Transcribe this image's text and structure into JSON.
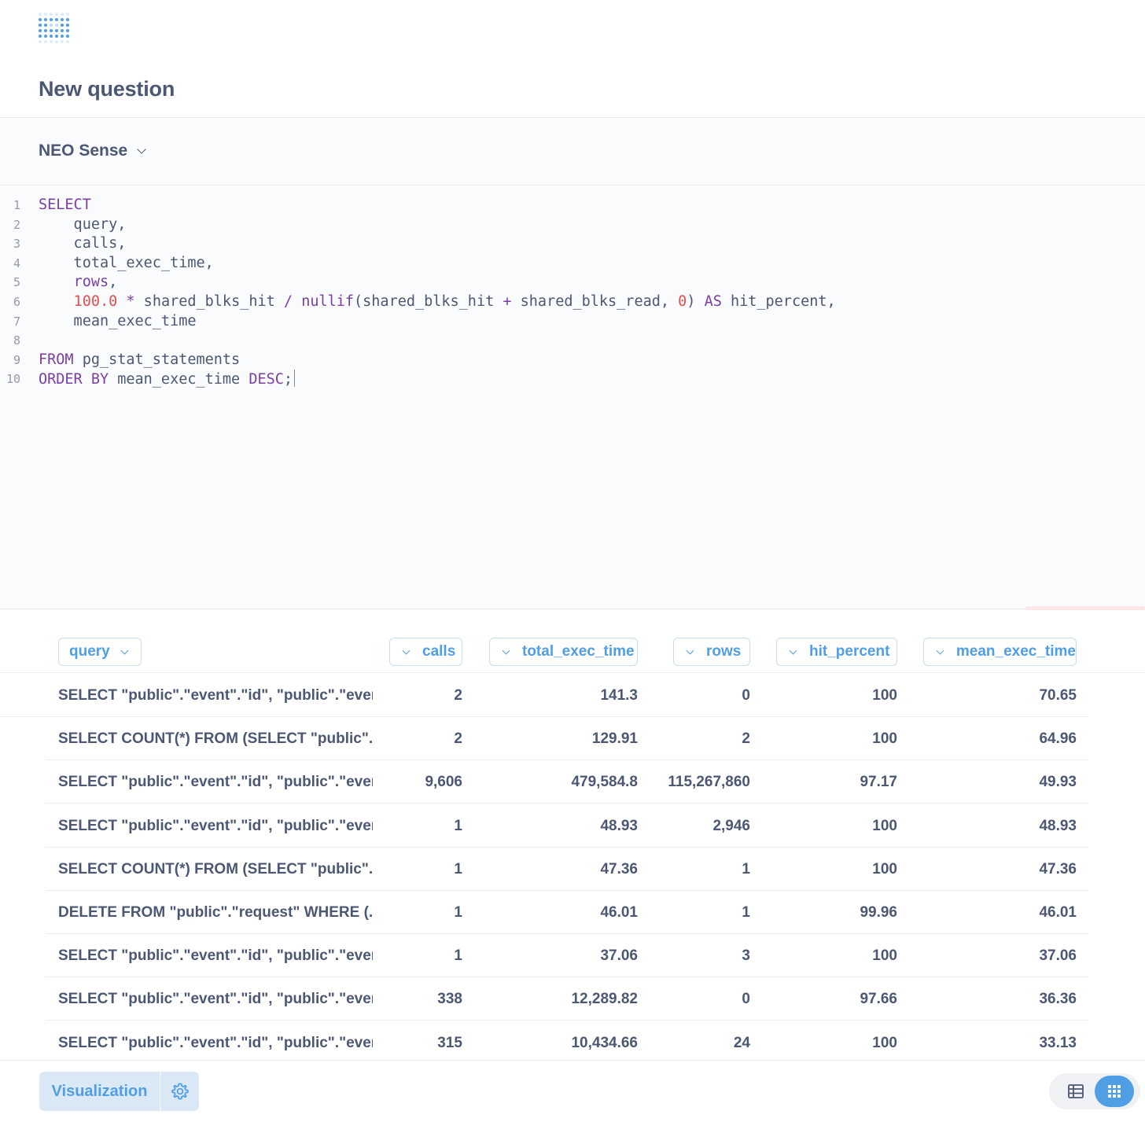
{
  "header": {
    "title": "New question"
  },
  "database": {
    "name": "NEO Sense"
  },
  "editor": {
    "lines": [
      {
        "n": "1",
        "html": "<span class=\"kw\">SELECT</span>"
      },
      {
        "n": "2",
        "html": "    query,"
      },
      {
        "n": "3",
        "html": "    calls,"
      },
      {
        "n": "4",
        "html": "    total_exec_time,"
      },
      {
        "n": "5",
        "html": "    <span class=\"fn\">rows</span>,"
      },
      {
        "n": "6",
        "html": "    <span class=\"num\">100.0</span> <span class=\"op\">*</span> shared_blks_hit <span class=\"op\">/</span> <span class=\"fn\">nullif</span>(shared_blks_hit <span class=\"op\">+</span> shared_blks_read, <span class=\"num\">0</span>) <span class=\"kw\">AS</span> hit_percent,"
      },
      {
        "n": "7",
        "html": "    mean_exec_time"
      },
      {
        "n": "8",
        "html": ""
      },
      {
        "n": "9",
        "html": "<span class=\"kw\">FROM</span> pg_stat_statements"
      },
      {
        "n": "10",
        "html": "<span class=\"kw\">ORDER BY</span> mean_exec_time <span class=\"kw\">DESC</span>;<span class=\"cursor\"></span>"
      }
    ]
  },
  "table": {
    "columns": [
      "query",
      "calls",
      "total_exec_time",
      "rows",
      "hit_percent",
      "mean_exec_time"
    ],
    "rows": [
      [
        "SELECT \"public\".\"event\".\"id\", \"public\".\"event\"...",
        "2",
        "141.3",
        "0",
        "100",
        "70.65"
      ],
      [
        "SELECT COUNT(*) FROM (SELECT \"public\"...",
        "2",
        "129.91",
        "2",
        "100",
        "64.96"
      ],
      [
        "SELECT \"public\".\"event\".\"id\", \"public\".\"event\"...",
        "9,606",
        "479,584.8",
        "115,267,860",
        "97.17",
        "49.93"
      ],
      [
        "SELECT \"public\".\"event\".\"id\", \"public\".\"event\"...",
        "1",
        "48.93",
        "2,946",
        "100",
        "48.93"
      ],
      [
        "SELECT COUNT(*) FROM (SELECT \"public\"...",
        "1",
        "47.36",
        "1",
        "100",
        "47.36"
      ],
      [
        "DELETE FROM \"public\".\"request\" WHERE (...",
        "1",
        "46.01",
        "1",
        "99.96",
        "46.01"
      ],
      [
        "SELECT \"public\".\"event\".\"id\", \"public\".\"event\"...",
        "1",
        "37.06",
        "3",
        "100",
        "37.06"
      ],
      [
        "SELECT \"public\".\"event\".\"id\", \"public\".\"event\"...",
        "338",
        "12,289.82",
        "0",
        "97.66",
        "36.36"
      ],
      [
        "SELECT \"public\".\"event\".\"id\", \"public\".\"event\"...",
        "315",
        "10,434.66",
        "24",
        "100",
        "33.13"
      ]
    ]
  },
  "footer": {
    "visualization_label": "Visualization"
  },
  "colors": {
    "brand": "#509ee3",
    "text": "#4c5773",
    "keyword": "#7b3ea5",
    "number": "#e35050"
  },
  "icons": [
    "metabase-logo-icon",
    "chevron-down-icon",
    "gear-icon",
    "table-icon",
    "grid-icon"
  ]
}
